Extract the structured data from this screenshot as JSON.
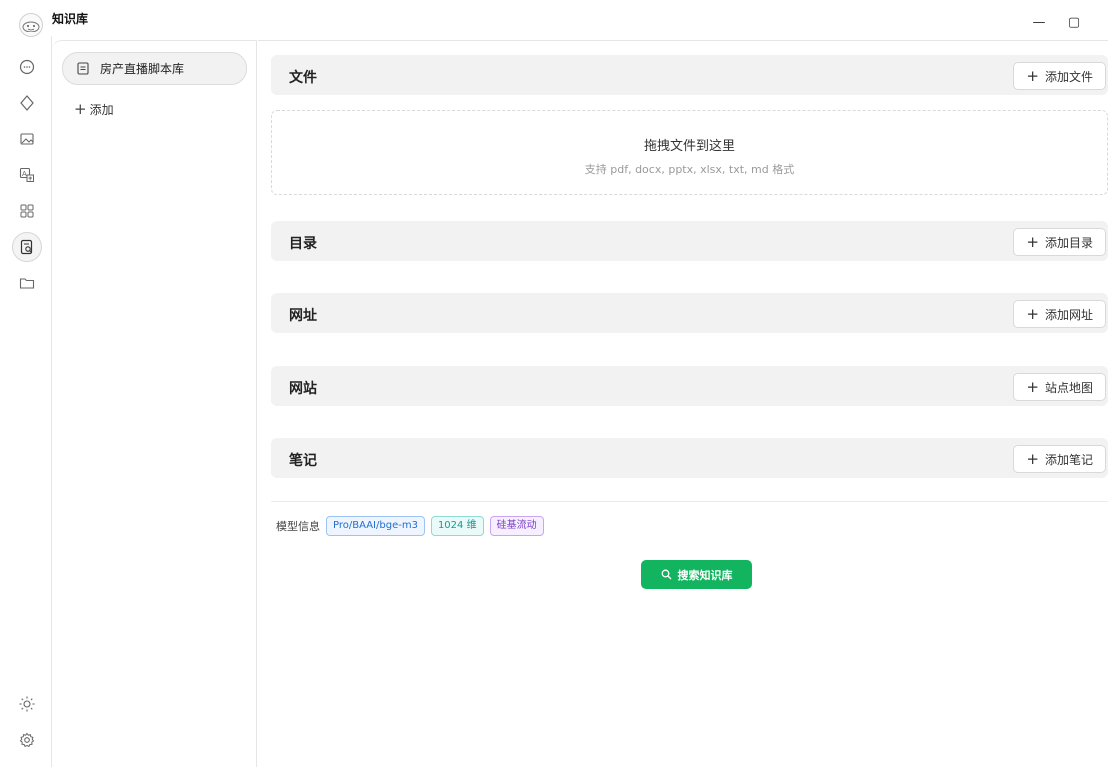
{
  "window": {
    "title": "知识库",
    "minimize_glyph": "—",
    "maximize_glyph": "▢"
  },
  "rail": {
    "items": [
      {
        "icon": "chat-bubble-icon"
      },
      {
        "icon": "sparkle-icon"
      },
      {
        "icon": "image-icon"
      },
      {
        "icon": "translate-icon"
      },
      {
        "icon": "apps-grid-icon"
      },
      {
        "icon": "knowledge-search-icon",
        "active": true
      },
      {
        "icon": "folder-icon"
      }
    ],
    "bottom": [
      {
        "icon": "theme-sun-icon"
      },
      {
        "icon": "settings-gear-icon"
      }
    ]
  },
  "kb_list": {
    "items": [
      {
        "label": "房产直播脚本库",
        "icon": "document-icon",
        "selected": true
      }
    ],
    "add_label": "添加"
  },
  "sections": [
    {
      "title": "文件",
      "button": "添加文件"
    },
    {
      "title": "目录",
      "button": "添加目录"
    },
    {
      "title": "网址",
      "button": "添加网址"
    },
    {
      "title": "网站",
      "button": "站点地图"
    },
    {
      "title": "笔记",
      "button": "添加笔记"
    }
  ],
  "dropzone": {
    "title": "拖拽文件到这里",
    "subtitle": "支持 pdf, docx, pptx, xlsx, txt, md 格式"
  },
  "model_info": {
    "label": "模型信息",
    "model": "Pro/BAAI/bge-m3",
    "dimensions": "1024 维",
    "provider": "硅基流动"
  },
  "search_button": "搜索知识库",
  "colors": {
    "accent_green": "#13b45f",
    "tag_blue": "#1f6fd0",
    "tag_cyan": "#149a93",
    "tag_purple": "#7a3fc8"
  }
}
